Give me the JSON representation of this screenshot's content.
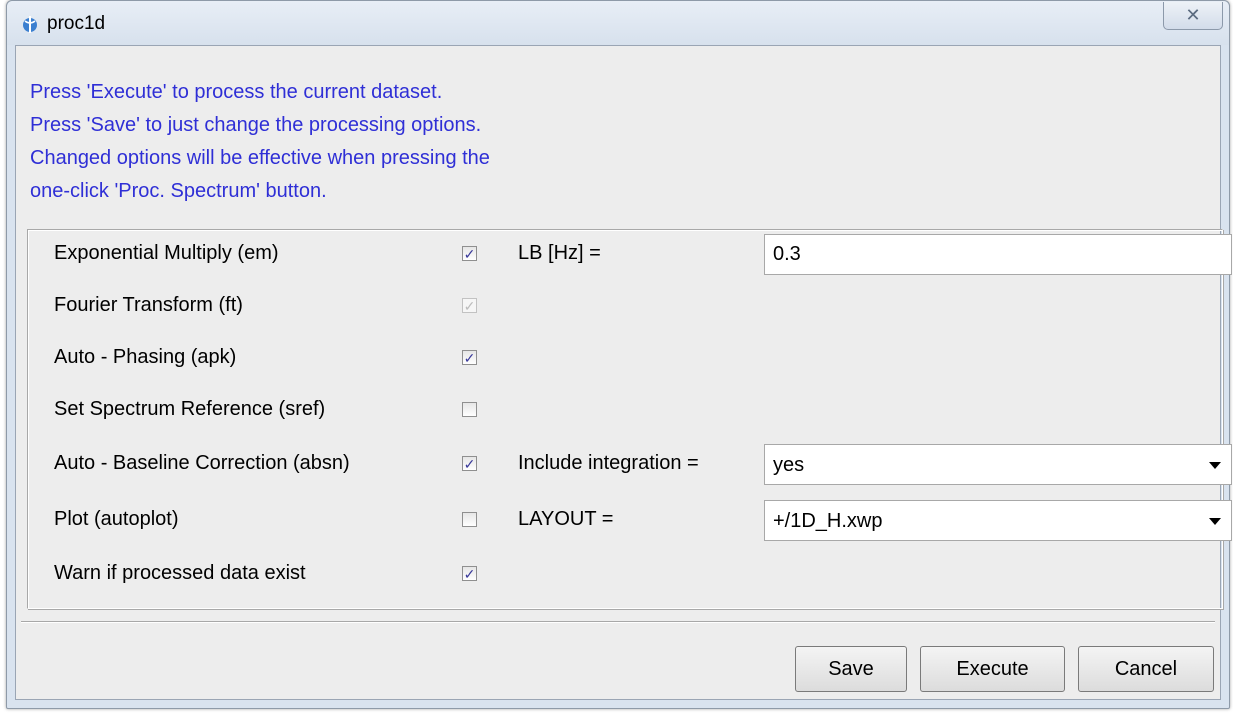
{
  "window": {
    "title": "proc1d",
    "close_symbol": "✕"
  },
  "info_lines": [
    "Press 'Execute' to process the current dataset.",
    "Press 'Save' to just change the processing options.",
    "Changed options will be effective when pressing the",
    "one-click 'Proc. Spectrum' button."
  ],
  "options": [
    {
      "label": "Exponential Multiply (em)",
      "checked": true,
      "enabled": true
    },
    {
      "label": "Fourier Transform (ft)",
      "checked": true,
      "enabled": false
    },
    {
      "label": "Auto - Phasing (apk)",
      "checked": true,
      "enabled": true
    },
    {
      "label": "Set Spectrum Reference (sref)",
      "checked": false,
      "enabled": true
    },
    {
      "label": "Auto - Baseline Correction (absn)",
      "checked": true,
      "enabled": true
    },
    {
      "label": "Plot (autoplot)",
      "checked": false,
      "enabled": true
    },
    {
      "label": "Warn if processed data exist",
      "checked": true,
      "enabled": true
    }
  ],
  "fields": {
    "lb": {
      "label": "LB [Hz] =",
      "value": "0.3"
    },
    "integration": {
      "label": "Include integration =",
      "value": "yes"
    },
    "layout": {
      "label": "LAYOUT =",
      "value": "+/1D_H.xwp"
    }
  },
  "buttons": {
    "save": "Save",
    "execute": "Execute",
    "cancel": "Cancel"
  },
  "check_glyph": "✓",
  "colors": {
    "info_text": "#2f2fd6",
    "window_frame": "#d9e3ef",
    "dialog_background": "#ededed"
  }
}
